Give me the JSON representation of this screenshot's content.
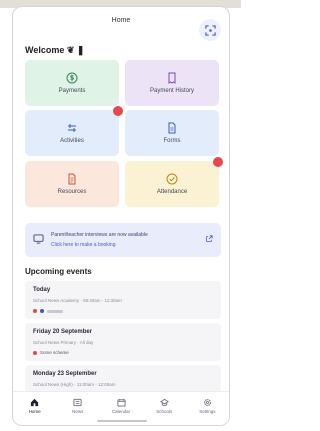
{
  "header": {
    "title": "Home",
    "scan_icon": "qr-scan-icon"
  },
  "welcome": "Welcome ❦ ❚",
  "tiles": [
    {
      "label": "Payments",
      "icon": "dollar-icon",
      "bg": "#dff3e6",
      "accent": "#2e8b57"
    },
    {
      "label": "Payment History",
      "icon": "receipt-icon",
      "bg": "#ece3f7",
      "accent": "#7b4bb7"
    },
    {
      "label": "Activities",
      "icon": "activities-icon",
      "bg": "#e3ecfb",
      "accent": "#3b5bb5",
      "badge": ""
    },
    {
      "label": "Forms",
      "icon": "form-icon",
      "bg": "#e3ecfb",
      "accent": "#3b5bb5"
    },
    {
      "label": "Resources",
      "icon": "folder-icon",
      "bg": "#fbe7dc",
      "accent": "#c0582c"
    },
    {
      "label": "Attendance",
      "icon": "check-circle-icon",
      "bg": "#fbf2d3",
      "accent": "#b58a12",
      "badge": ""
    }
  ],
  "banner": {
    "line1": "Parent/teacher interviews are now available",
    "line2": "Click here to make a booking",
    "icon": "monitor-icon",
    "arrow_icon": "external-link-icon"
  },
  "events_title": "Upcoming events",
  "events": [
    {
      "day": "Today",
      "line": "School News Academy · 08:40am - 11:30am",
      "tag": ""
    },
    {
      "day": "Friday 20 September",
      "line": "School News Primary · All day",
      "tag": "Some scheme"
    },
    {
      "day": "Monday 23 September",
      "line": "School News (High) · 11:00am - 12:00am",
      "tag": ""
    }
  ],
  "tabs": [
    {
      "label": "Home",
      "icon": "home-icon"
    },
    {
      "label": "News",
      "icon": "news-icon"
    },
    {
      "label": "Calendar",
      "icon": "calendar-icon"
    },
    {
      "label": "Schools",
      "icon": "school-icon"
    },
    {
      "label": "Settings",
      "icon": "settings-icon"
    }
  ],
  "colors": {
    "badge": "#e5484d",
    "banner_bg": "#e9ecfb",
    "link": "#4a5bd0"
  }
}
